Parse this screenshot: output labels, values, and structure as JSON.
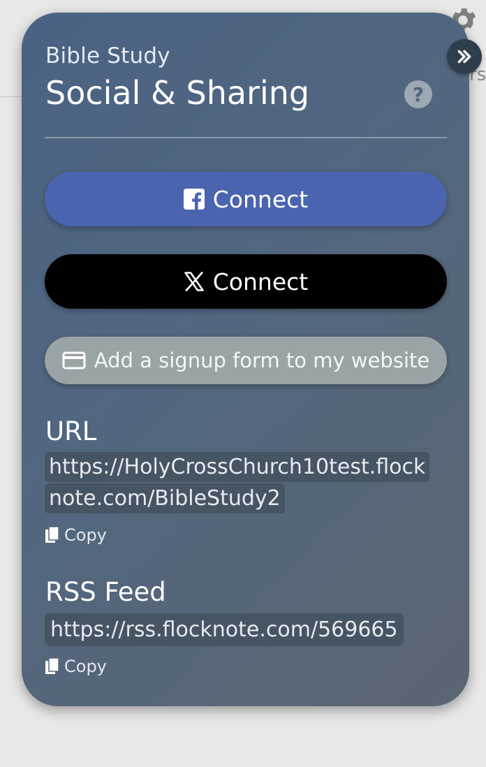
{
  "background": {
    "partial_text": "rs"
  },
  "header": {
    "subtitle": "Bible Study",
    "title": "Social & Sharing",
    "help_glyph": "?"
  },
  "buttons": {
    "facebook_label": "Connect",
    "x_label": "Connect",
    "signup_label": "Add a signup form to my website"
  },
  "url_section": {
    "label": "URL",
    "value": "https://HolyCrossChurch10test.flocknote.com/BibleStudy2",
    "copy_label": "Copy"
  },
  "rss_section": {
    "label": "RSS Feed",
    "value": "https://rss.flocknote.com/569665",
    "copy_label": "Copy"
  },
  "icons": [
    "gear-icon",
    "chevrons-right-icon",
    "help-icon",
    "facebook-icon",
    "x-logo-icon",
    "credit-card-icon",
    "copy-icon"
  ],
  "colors": {
    "facebook": "#4a64b0",
    "x": "#000000",
    "signup": "#9aa3a6",
    "card": "#4f6481"
  }
}
